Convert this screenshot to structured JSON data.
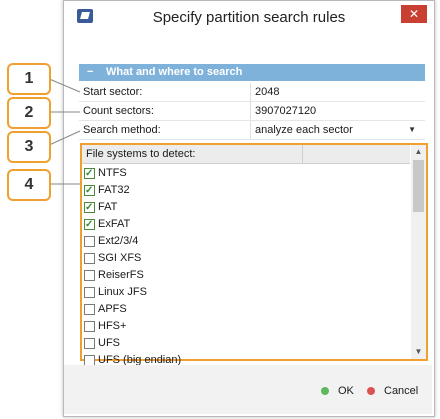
{
  "dialog": {
    "title": "Specify partition search rules",
    "close_glyph": "✕",
    "icon": "app-icon"
  },
  "section": {
    "collapse_glyph": "−",
    "title": "What and where to search"
  },
  "properties": [
    {
      "key": "Start sector:",
      "value": "2048"
    },
    {
      "key": "Count sectors:",
      "value": "3907027120"
    },
    {
      "key": "Search method:",
      "value": "analyze each sector"
    }
  ],
  "dropdown_glyph": "▼",
  "filesystems": {
    "header": "File systems to detect:",
    "items": [
      {
        "label": "NTFS",
        "checked": true
      },
      {
        "label": "FAT32",
        "checked": true
      },
      {
        "label": "FAT",
        "checked": true
      },
      {
        "label": "ExFAT",
        "checked": true
      },
      {
        "label": "Ext2/3/4",
        "checked": false
      },
      {
        "label": "SGI XFS",
        "checked": false
      },
      {
        "label": "ReiserFS",
        "checked": false
      },
      {
        "label": "Linux JFS",
        "checked": false
      },
      {
        "label": "APFS",
        "checked": false
      },
      {
        "label": "HFS+",
        "checked": false
      },
      {
        "label": "UFS",
        "checked": false
      },
      {
        "label": "UFS (big endian)",
        "checked": false
      }
    ],
    "scroll_up_glyph": "▲",
    "scroll_down_glyph": "▼"
  },
  "callouts": [
    "1",
    "2",
    "3",
    "4"
  ],
  "buttons": {
    "ok": {
      "label": "OK",
      "color": "#5cb85c"
    },
    "cancel": {
      "label": "Cancel",
      "color": "#d9534f"
    }
  },
  "colors": {
    "accent": "#7fb2db",
    "callout_border": "#f0a030"
  }
}
